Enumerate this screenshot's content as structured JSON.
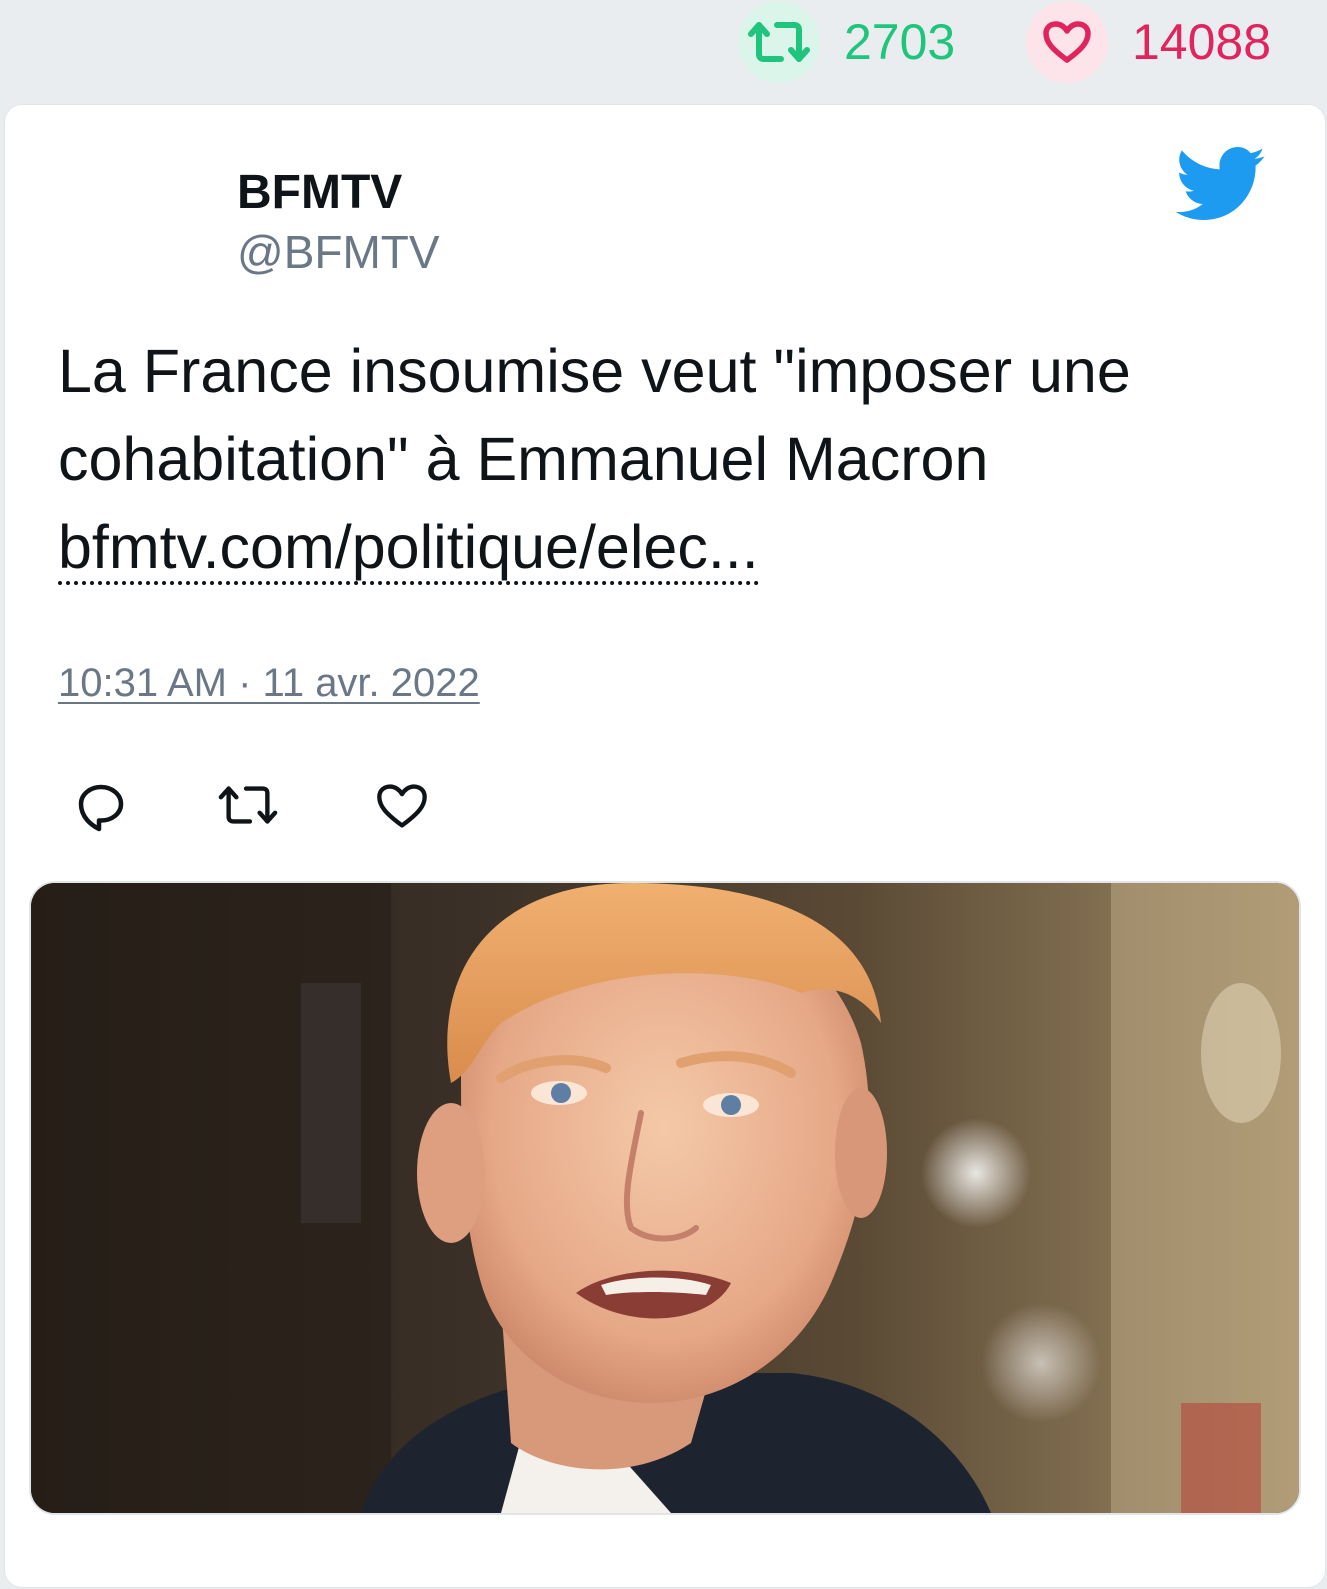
{
  "stats": {
    "retweets": "2703",
    "likes": "14088",
    "retweet_color": "#1fc47d",
    "like_color": "#e0245e"
  },
  "tweet": {
    "author_name": "BFMTV",
    "author_handle": "@BFMTV",
    "text": "La France insoumise veut \"imposer une cohabitation\" à Emmanuel Macron",
    "link": "bfmtv.com/politique/elec...",
    "timestamp": "10:31 AM · 11 avr. 2022"
  },
  "icons": {
    "brand": "twitter-bird-icon",
    "reply": "reply-icon",
    "retweet": "retweet-icon",
    "like": "heart-icon"
  },
  "brand_color": "#1d9bf0"
}
